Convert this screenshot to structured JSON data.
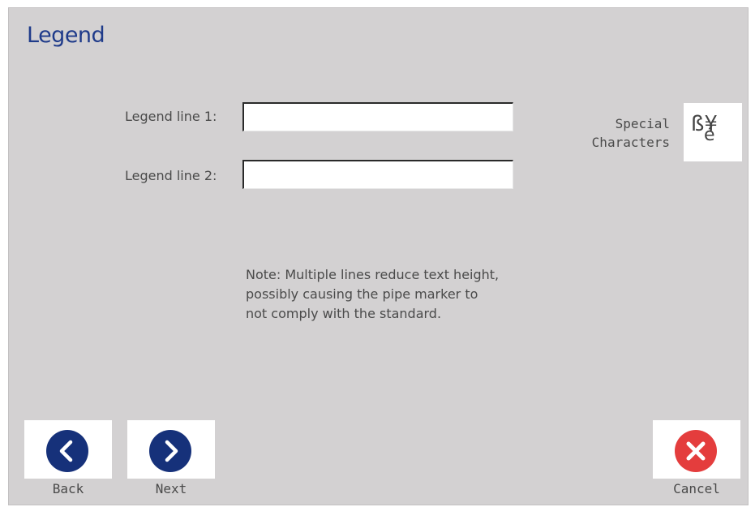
{
  "page": {
    "title": "Legend"
  },
  "fields": [
    {
      "label": "Legend line 1:",
      "value": "",
      "placeholder": ""
    },
    {
      "label": "Legend line 2:",
      "value": "",
      "placeholder": ""
    }
  ],
  "note": "Note: Multiple lines reduce text height,\npossibly causing the pipe marker to\nnot comply with the standard.",
  "special_characters": {
    "label": "Special\nCharacters",
    "glyph_top": "ß¥",
    "glyph_bottom": "é",
    "icon": "special-characters-icon"
  },
  "footer": {
    "back": {
      "label": "Back",
      "icon": "chevron-left-icon",
      "color": "#16317a"
    },
    "next": {
      "label": "Next",
      "icon": "chevron-right-icon",
      "color": "#16317a"
    },
    "cancel": {
      "label": "Cancel",
      "icon": "close-icon",
      "color": "#e43d3d"
    }
  },
  "colors": {
    "background": "#d3d1d2",
    "title": "#1f3b8a",
    "text": "#4a4a4a",
    "button_face": "#ffffff"
  }
}
